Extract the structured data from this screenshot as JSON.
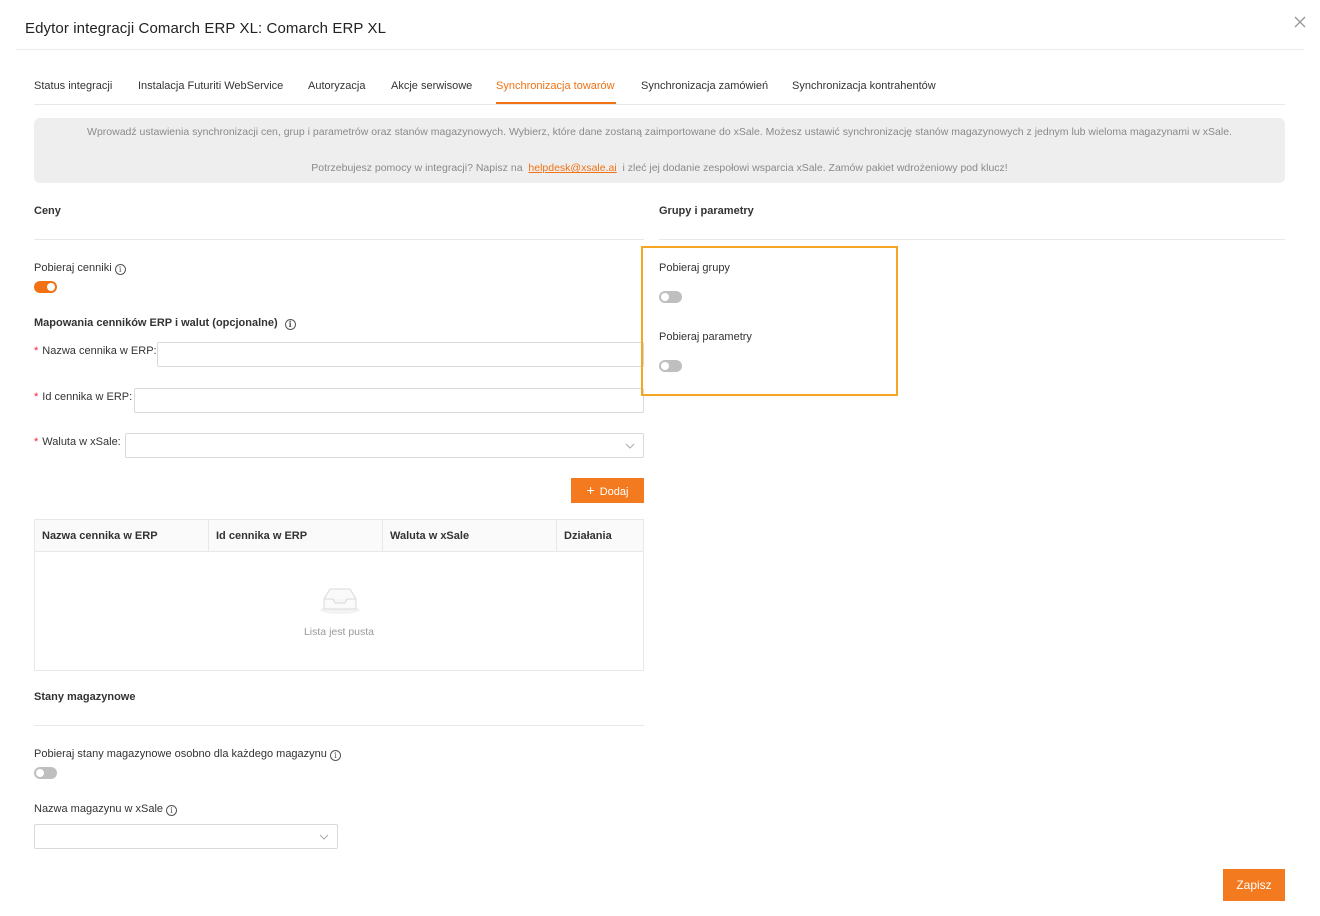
{
  "dialog": {
    "title": "Edytor integracji Comarch ERP XL: Comarch ERP XL",
    "close_icon": "close-icon"
  },
  "tabs": [
    {
      "label": "Status integracji",
      "active": false
    },
    {
      "label": "Instalacja Futuriti WebService",
      "active": false
    },
    {
      "label": "Autoryzacja",
      "active": false
    },
    {
      "label": "Akcje serwisowe",
      "active": false
    },
    {
      "label": "Synchronizacja towarów",
      "active": true
    },
    {
      "label": "Synchronizacja zamówień",
      "active": false
    },
    {
      "label": "Synchronizacja kontrahentów",
      "active": false
    }
  ],
  "info": {
    "line1": "Wprowadź ustawienia synchronizacji cen, grup i parametrów oraz stanów magazynowych. Wybierz, które dane zostaną zaimportowane do xSale. Możesz ustawić synchronizację stanów magazynowych z jednym lub wieloma magazynami w xSale.",
    "line2_before": "Potrzebujesz pomocy w integracji? Napisz na",
    "line2_link": "helpdesk@xsale.ai",
    "line2_after": "i zleć jej dodanie zespołowi wsparcia xSale. Zamów pakiet wdrożeniowy pod klucz!"
  },
  "prices": {
    "section_title": "Ceny",
    "fetch_pricelists_label": "Pobieraj cenniki",
    "fetch_pricelists_on": true,
    "mapping_title": "Mapowania cenników ERP i walut (opcjonalne)",
    "required_mark": "*",
    "pricelist_name_label": "Nazwa cennika w ERP:",
    "pricelist_name_value": "",
    "pricelist_id_label": "Id cennika w ERP:",
    "pricelist_id_value": "",
    "currency_label": "Waluta w xSale:",
    "currency_value": "",
    "add_button": "Dodaj",
    "add_icon": "+",
    "table": {
      "columns": [
        "Nazwa cennika w ERP",
        "Id cennika w ERP",
        "Waluta w xSale",
        "Działania"
      ],
      "rows": [],
      "empty_text": "Lista jest pusta"
    }
  },
  "groups": {
    "section_title": "Grupy i parametry",
    "fetch_groups_label": "Pobieraj grupy",
    "fetch_groups_on": false,
    "fetch_params_label": "Pobieraj parametry",
    "fetch_params_on": false,
    "highlight_color": "#f5a623"
  },
  "stock": {
    "section_title": "Stany magazynowe",
    "per_warehouse_label": "Pobieraj stany magazynowe osobno dla każdego magazynu",
    "per_warehouse_on": false,
    "warehouse_name_label": "Nazwa magazynu w xSale",
    "warehouse_name_value": ""
  },
  "footer": {
    "save_button": "Zapisz"
  },
  "colors": {
    "accent": "#f07214",
    "button": "#f47a1f",
    "highlight": "#f5a623"
  }
}
